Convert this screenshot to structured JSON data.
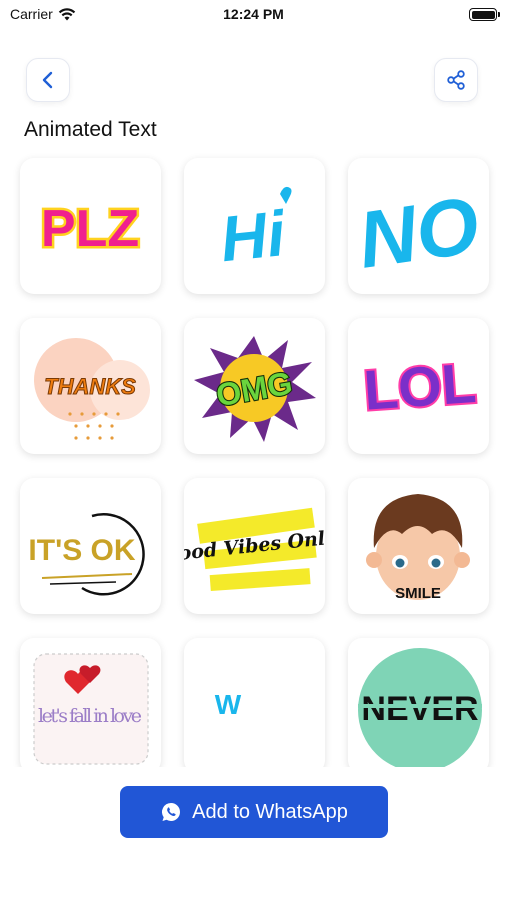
{
  "status_bar": {
    "carrier": "Carrier",
    "time": "12:24 PM"
  },
  "header": {
    "back_icon": "chevron-left-icon",
    "share_icon": "share-icon",
    "title": "Animated Text"
  },
  "stickers": [
    {
      "label": "PLZ"
    },
    {
      "label": "Hi"
    },
    {
      "label": "NO"
    },
    {
      "label": "THANKS"
    },
    {
      "label": "OMG"
    },
    {
      "label": "LOL"
    },
    {
      "label": "IT'S OK"
    },
    {
      "label": "Good Vibes Only!"
    },
    {
      "label": "SMILE"
    },
    {
      "label": "let's fall in love"
    },
    {
      "label": "W"
    },
    {
      "label": "NEVER"
    }
  ],
  "footer": {
    "button_label": "Add to WhatsApp",
    "button_icon": "whatsapp-icon"
  },
  "colors": {
    "accent": "#2156d6",
    "nav_icon": "#1f5fd6"
  }
}
